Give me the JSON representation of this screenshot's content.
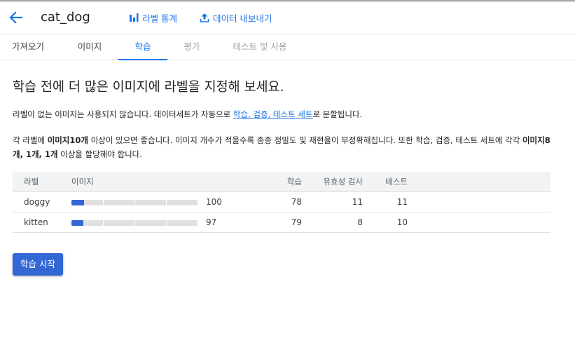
{
  "header": {
    "title": "cat_dog",
    "stats_label": "라벨 통계",
    "export_label": "데이터 내보내기"
  },
  "tabs": [
    {
      "label": "가져오기",
      "state": "normal"
    },
    {
      "label": "이미지",
      "state": "normal"
    },
    {
      "label": "학습",
      "state": "active"
    },
    {
      "label": "평가",
      "state": "disabled"
    },
    {
      "label": "테스트 및 사용",
      "state": "disabled"
    }
  ],
  "main": {
    "heading": "학습 전에 더 많은 이미지에 라벨을 지정해 보세요.",
    "p1_before": "라벨이 없는 이미지는 사용되지 않습니다. 데이터세트가 자동으로 ",
    "p1_link": "학습, 검증, 테스트 세트",
    "p1_after": "로 분할됩니다.",
    "p2_a": "각 라벨에 ",
    "p2_b": "이미지10개",
    "p2_c": " 이상이 있으면 좋습니다. 이미지 개수가 적을수록 종종 정밀도 및 재현율이 부정확해집니다. 또한 학습, 검증, 테스트 세트에 각각 ",
    "p2_d": "이미지8개, 1개, 1개",
    "p2_e": " 이상을 할당해야 합니다."
  },
  "table": {
    "headers": {
      "label": "라벨",
      "images": "이미지",
      "train": "학습",
      "validation": "유효성 검사",
      "test": "테스트"
    },
    "rows": [
      {
        "label": "doggy",
        "images": 100,
        "train": 78,
        "validation": 11,
        "test": 11,
        "progress": 0.1
      },
      {
        "label": "kitten",
        "images": 97,
        "train": 79,
        "validation": 8,
        "test": 10,
        "progress": 0.095
      }
    ]
  },
  "actions": {
    "start_label": "학습 시작"
  },
  "colors": {
    "accent": "#1a73e8",
    "button": "#3367d6",
    "bar_fill": "#3367d6",
    "bar_track": "#e0e0e0"
  }
}
